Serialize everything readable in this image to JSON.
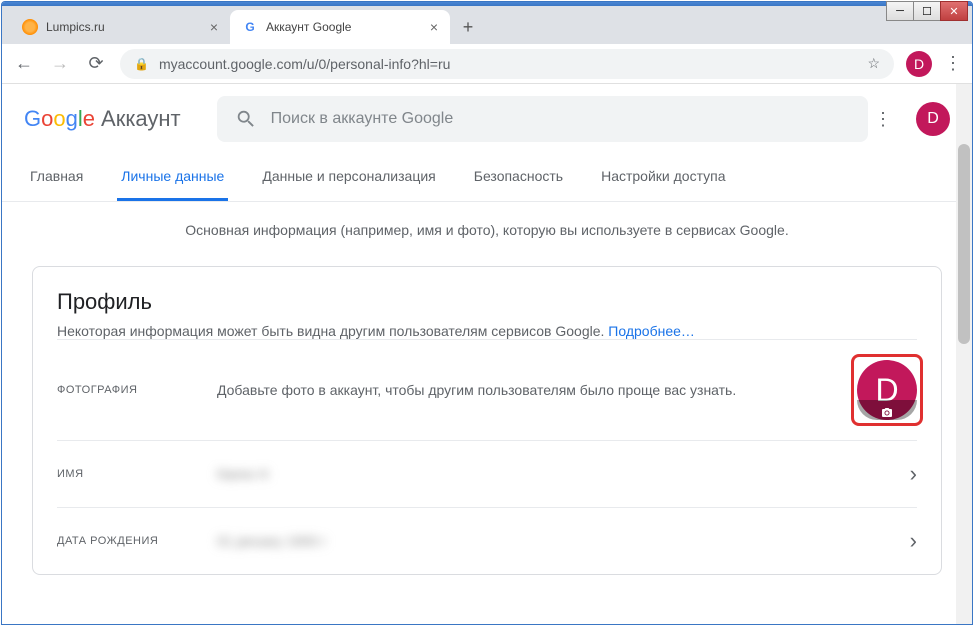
{
  "window": {
    "avatar_letter": "D"
  },
  "tabs": [
    {
      "title": "Lumpics.ru"
    },
    {
      "title": "Аккаунт Google"
    }
  ],
  "address_bar": {
    "url": "myaccount.google.com/u/0/personal-info?hl=ru"
  },
  "header": {
    "brand": "Google",
    "product": "Аккаунт",
    "search_placeholder": "Поиск в аккаунте Google"
  },
  "navtabs": [
    {
      "label": "Главная"
    },
    {
      "label": "Личные данные"
    },
    {
      "label": "Данные и персонализация"
    },
    {
      "label": "Безопасность"
    },
    {
      "label": "Настройки доступа"
    }
  ],
  "intro": "Основная информация (например, имя и фото), которую вы используете в сервисах Google.",
  "profile": {
    "title": "Профиль",
    "subtitle": "Некоторая информация может быть видна другим пользователям сервисов Google. ",
    "learn_more": "Подробнее…",
    "photo_label": "ФОТОГРАФИЯ",
    "photo_hint": "Добавьте фото в аккаунт, чтобы другим пользователям было проще вас узнать.",
    "name_label": "ИМЯ",
    "name_value": "Name H",
    "dob_label": "ДАТА РОЖДЕНИЯ",
    "dob_value": "01 january 1900 г"
  }
}
